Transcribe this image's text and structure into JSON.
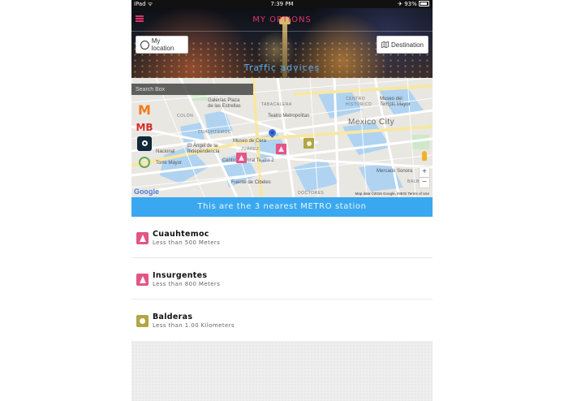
{
  "status_bar": {
    "device": "iPad",
    "time": "7:39 PM",
    "battery": "93%"
  },
  "header": {
    "title": "MY OPTIONS",
    "my_location_label": "My location",
    "destination_label": "Destination",
    "subtitle": "Traffic advices"
  },
  "map": {
    "search_placeholder": "Search Box",
    "labels": {
      "galerias": "Galerías Plaza\nde las Estrellas",
      "tabacalera": "TABACALERA",
      "centro_historico": "CENTRO\nHISTÓRICO",
      "museo_templo": "Museo del\nTemplo Mayor",
      "teatro_metropolitan": "Teatro Metropolitan",
      "mexico_city": "Mexico City",
      "cuauhtemoc": "CUAUHTÉMOC",
      "angel": "El Ángel de la\nIndependencia",
      "museo_cera": "Museo de Cera",
      "juarez": "JUÁREZ",
      "nacional": "Nacional",
      "torre_mayor": "Torre Mayor",
      "centro_cultural": "Centro Cultural Teatro 2",
      "mercado_sonora": "Mercado Sonora",
      "fuente_cibeles": "Fuente de Cibeles",
      "doctores": "DOCTORES",
      "colon": "COLÓN",
      "balb": "BALB",
      "google": "Google",
      "attribution": "Map data ©2016 Google, INEGI   Terms of Use"
    }
  },
  "banner": "This are the 3 nearest METRO station",
  "stations": [
    {
      "name": "Cuauhtemoc",
      "distance": "Less than 500 Meters",
      "icon": "metro-station-icon",
      "color": "#e35586"
    },
    {
      "name": "Insurgentes",
      "distance": "Less than 800 Meters",
      "icon": "metro-station-icon",
      "color": "#e35586"
    },
    {
      "name": "Balderas",
      "distance": "Less than 1.00 Kilometers",
      "icon": "metro-station-icon",
      "color": "#b1a642"
    }
  ],
  "colors": {
    "accent": "#e0336c",
    "banner": "#3aa8f0",
    "subtitle": "#58aef0"
  }
}
